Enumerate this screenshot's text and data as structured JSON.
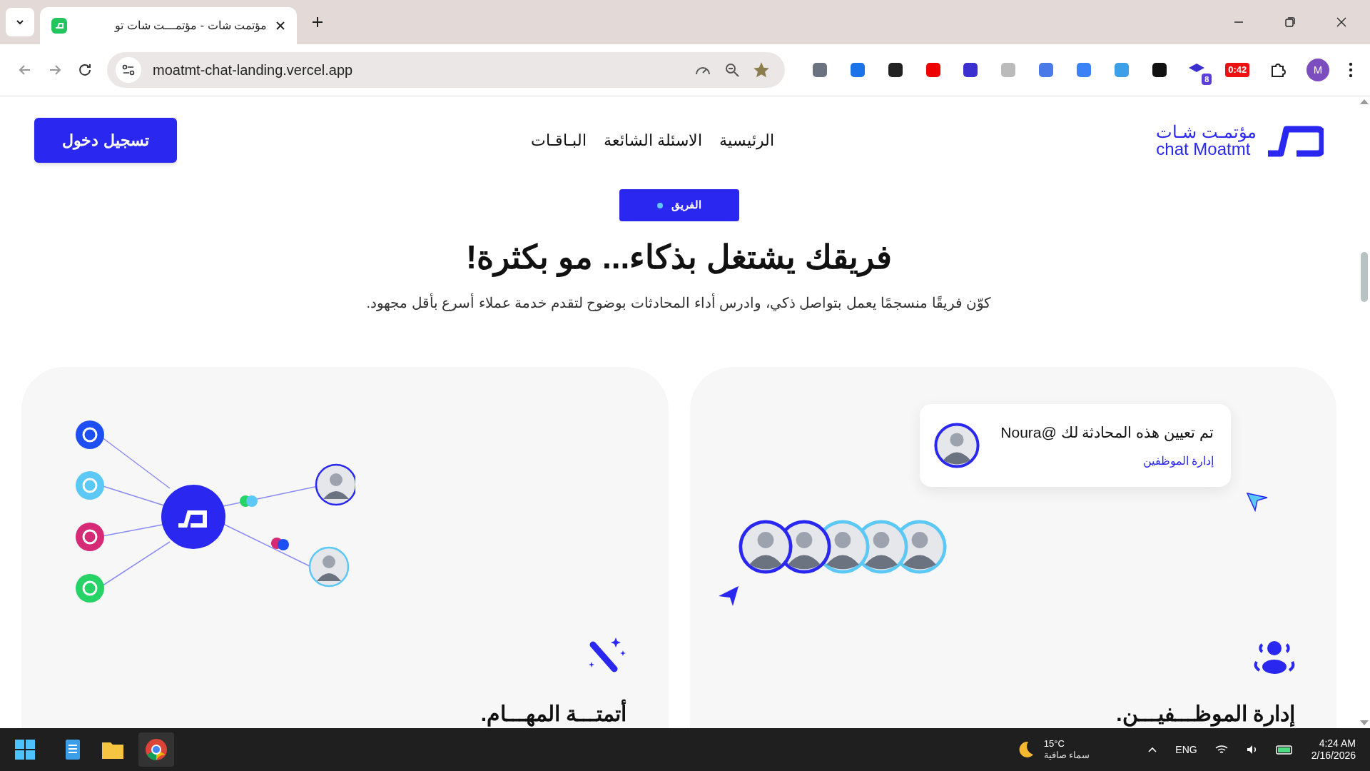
{
  "browser": {
    "tab_title": "مؤتمت شات - مؤتمـــت شات تو",
    "url": "moatmt-chat-landing.vercel.app",
    "extension_badge": "8",
    "timer_badge": "0:42",
    "profile_initial": "M"
  },
  "nav": {
    "logo_arabic": "مؤتمـت شـات",
    "logo_latin": "chat Moatmt",
    "links": [
      "الرئيسية",
      "الاسئلة الشائعة",
      "البـاقـات"
    ],
    "login": "تسجيل دخول"
  },
  "hero": {
    "badge": "الفريق",
    "title": "فريقك يشتغل بذكاء... مو بكثرة!",
    "subtitle": "كوّن فريقًا منسجمًا يعمل بتواصل ذكي، وادرس أداء المحادثات بوضوح لتقدم خدمة عملاء أسرع بأقل مجهود."
  },
  "cards": [
    {
      "kind": "staff",
      "title": "إدارة الموظـــفيـــن.",
      "notification": {
        "message": "تم تعيين هذه المحادثة لك @Noura",
        "link": "إدارة الموظفين"
      }
    },
    {
      "kind": "automation",
      "title": "أتمتـــة المهـــام."
    }
  ],
  "taskbar": {
    "temperature": "15°C",
    "weather": "سماء صافية",
    "language": "ENG",
    "time": "4:24 AM",
    "date": "2/16/2026"
  }
}
